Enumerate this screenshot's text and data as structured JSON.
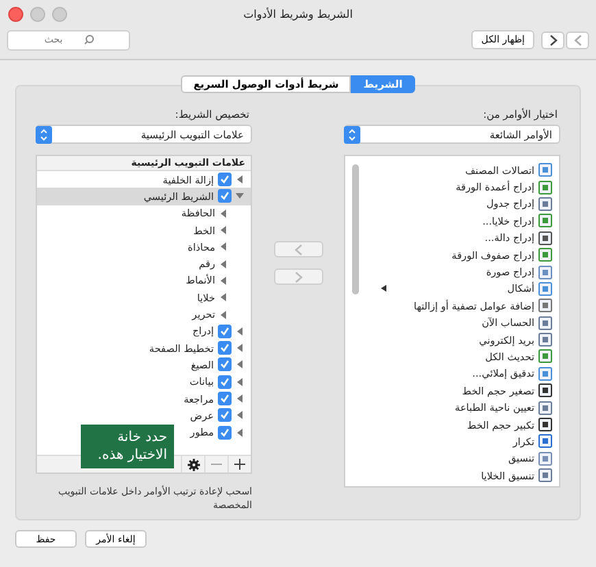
{
  "window": {
    "title": "الشريط وشريط الأدوات"
  },
  "toolbar": {
    "show_all": "إظهار الكل",
    "search": {
      "placeholder": "بحث"
    }
  },
  "tabs": [
    {
      "label": "الشريط",
      "selected": true
    },
    {
      "label": "شريط أدوات الوصول السريع",
      "selected": false
    }
  ],
  "commands": {
    "label": "اختيار الأوامر من:",
    "popup": "الأوامر الشائعة",
    "items": [
      {
        "label": "اتصالات المصنف",
        "submenu": false
      },
      {
        "label": "إدراج أعمدة الورقة",
        "submenu": false
      },
      {
        "label": "إدراج جدول",
        "submenu": false
      },
      {
        "label": "إدراج خلايا...",
        "submenu": false
      },
      {
        "label": "إدراج دالة...",
        "submenu": false
      },
      {
        "label": "إدراج صفوف الورقة",
        "submenu": false
      },
      {
        "label": "إدراج صورة",
        "submenu": false
      },
      {
        "label": "أشكال",
        "submenu": true
      },
      {
        "label": "إضافة عوامل تصفية أو إزالتها",
        "submenu": false
      },
      {
        "label": "الحساب الآن",
        "submenu": false
      },
      {
        "label": "بريد إلكتروني",
        "submenu": false
      },
      {
        "label": "تحديث الكل",
        "submenu": false
      },
      {
        "label": "تدقيق إملائي...",
        "submenu": false
      },
      {
        "label": "تصغير حجم الخط",
        "submenu": false
      },
      {
        "label": "تعيين ناحية الطباعة",
        "submenu": false
      },
      {
        "label": "تكبير حجم الخط",
        "submenu": false
      },
      {
        "label": "تكرار",
        "submenu": false
      },
      {
        "label": "تنسيق",
        "submenu": false
      },
      {
        "label": "تنسيق الخلايا",
        "submenu": false
      }
    ]
  },
  "customize": {
    "label": "تخصيص الشريط:",
    "popup": "علامات التبويب الرئيسية",
    "header": "علامات التبويب الرئيسية",
    "tree": [
      {
        "label": "إزالة الخلفية",
        "checked": true,
        "expanded": false,
        "selected": false
      },
      {
        "label": "الشريط الرئيسي",
        "checked": true,
        "expanded": true,
        "selected": true,
        "children": [
          {
            "label": "الحافظة"
          },
          {
            "label": "الخط"
          },
          {
            "label": "محاذاة"
          },
          {
            "label": "رقم"
          },
          {
            "label": "الأنماط"
          },
          {
            "label": "خلايا"
          },
          {
            "label": "تحرير"
          }
        ]
      },
      {
        "label": "إدراج",
        "checked": true,
        "expanded": false,
        "selected": false
      },
      {
        "label": "تخطيط الصفحة",
        "checked": true,
        "expanded": false,
        "selected": false
      },
      {
        "label": "الصيغ",
        "checked": true,
        "expanded": false,
        "selected": false
      },
      {
        "label": "بيانات",
        "checked": true,
        "expanded": false,
        "selected": false
      },
      {
        "label": "مراجعة",
        "checked": true,
        "expanded": false,
        "selected": false
      },
      {
        "label": "عرض",
        "checked": true,
        "expanded": false,
        "selected": false
      },
      {
        "label": "مطور",
        "checked": true,
        "expanded": false,
        "selected": false
      }
    ],
    "hint": "اسحب لإعادة ترتيب الأوامر داخل علامات التبويب المخصصة"
  },
  "callout": "حدد خانة الاختيار هذه.",
  "buttons": [
    {
      "label": "إلغاء الأمر"
    },
    {
      "label": "حفظ"
    }
  ]
}
